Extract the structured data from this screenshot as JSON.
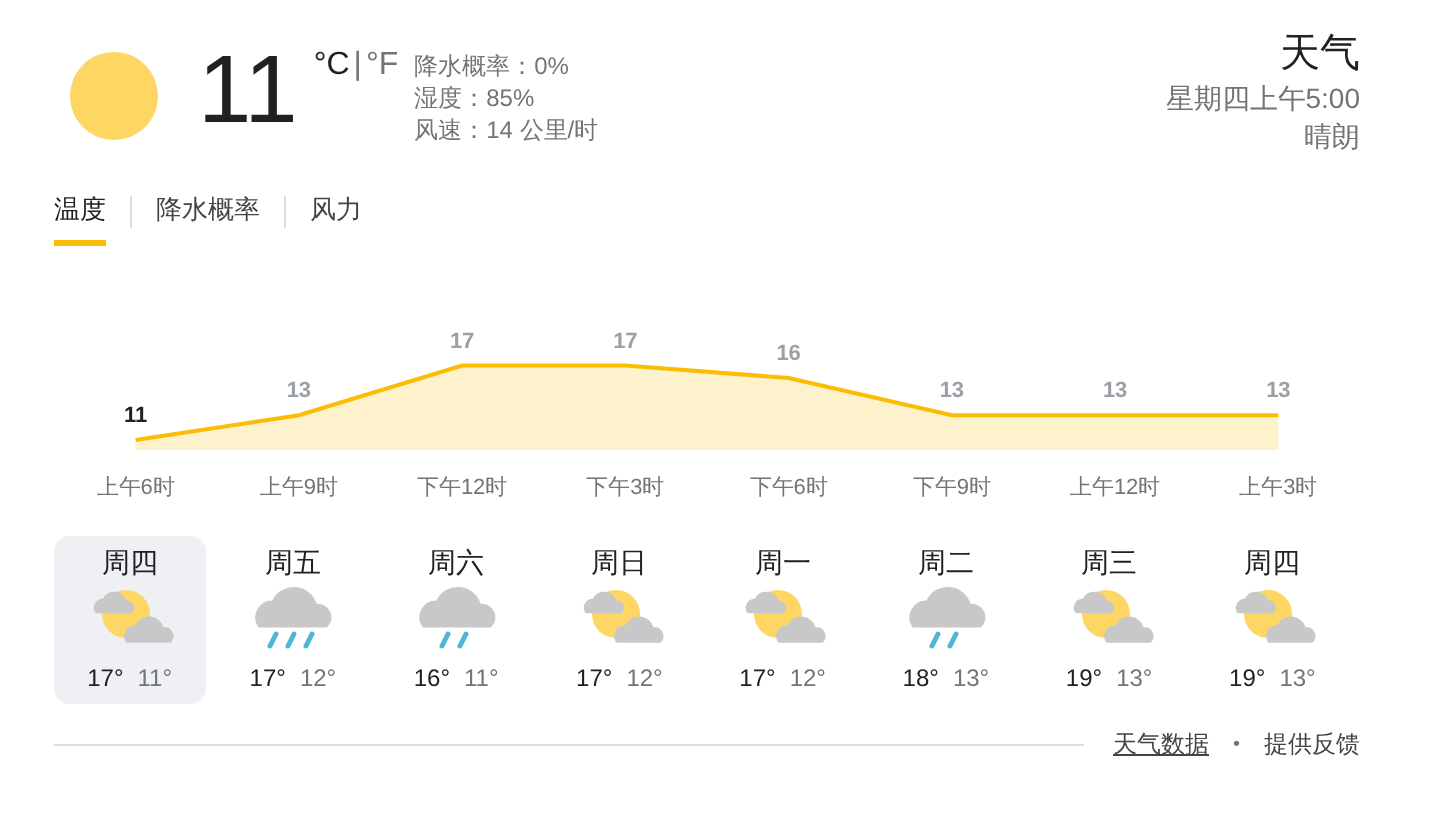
{
  "current": {
    "temperature": "11",
    "units": [
      {
        "label": "°C",
        "selected": true
      },
      {
        "label": "°F",
        "selected": false
      }
    ],
    "unit_separator": "|",
    "details": [
      "降水概率：0%",
      "湿度：85%",
      "风速：14 公里/时"
    ]
  },
  "header": {
    "title": "天气",
    "time": "星期四上午5:00",
    "condition": "晴朗"
  },
  "tabs": [
    {
      "label": "温度",
      "selected": true
    },
    {
      "label": "降水概率",
      "selected": false
    },
    {
      "label": "风力",
      "selected": false
    }
  ],
  "chart_data": {
    "type": "area",
    "categories": [
      "上午6时",
      "上午9时",
      "下午12时",
      "下午3时",
      "下午6时",
      "下午9时",
      "上午12时",
      "上午3时"
    ],
    "series": [
      {
        "color": "#fbbc04",
        "values": [
          11,
          13,
          17,
          17,
          16,
          13,
          13,
          13
        ]
      }
    ],
    "data_labels": true
  },
  "days": [
    {
      "day": "周四",
      "kind": "partly-cloudy",
      "high": "17°",
      "low": "11°",
      "selected": true
    },
    {
      "day": "周五",
      "kind": "rain",
      "high": "17°",
      "low": "12°",
      "selected": false
    },
    {
      "day": "周六",
      "kind": "light-rain",
      "high": "16°",
      "low": "11°",
      "selected": false
    },
    {
      "day": "周日",
      "kind": "partly-cloudy",
      "high": "17°",
      "low": "12°",
      "selected": false
    },
    {
      "day": "周一",
      "kind": "partly-cloudy",
      "high": "17°",
      "low": "12°",
      "selected": false
    },
    {
      "day": "周二",
      "kind": "light-rain",
      "high": "18°",
      "low": "13°",
      "selected": false
    },
    {
      "day": "周三",
      "kind": "partly-cloudy",
      "high": "19°",
      "low": "13°",
      "selected": false
    },
    {
      "day": "周四",
      "kind": "partly-cloudy",
      "high": "19°",
      "low": "13°",
      "selected": false
    }
  ],
  "footer": {
    "source_link": "天气数据",
    "separator": "•",
    "feedback": "提供反馈"
  }
}
